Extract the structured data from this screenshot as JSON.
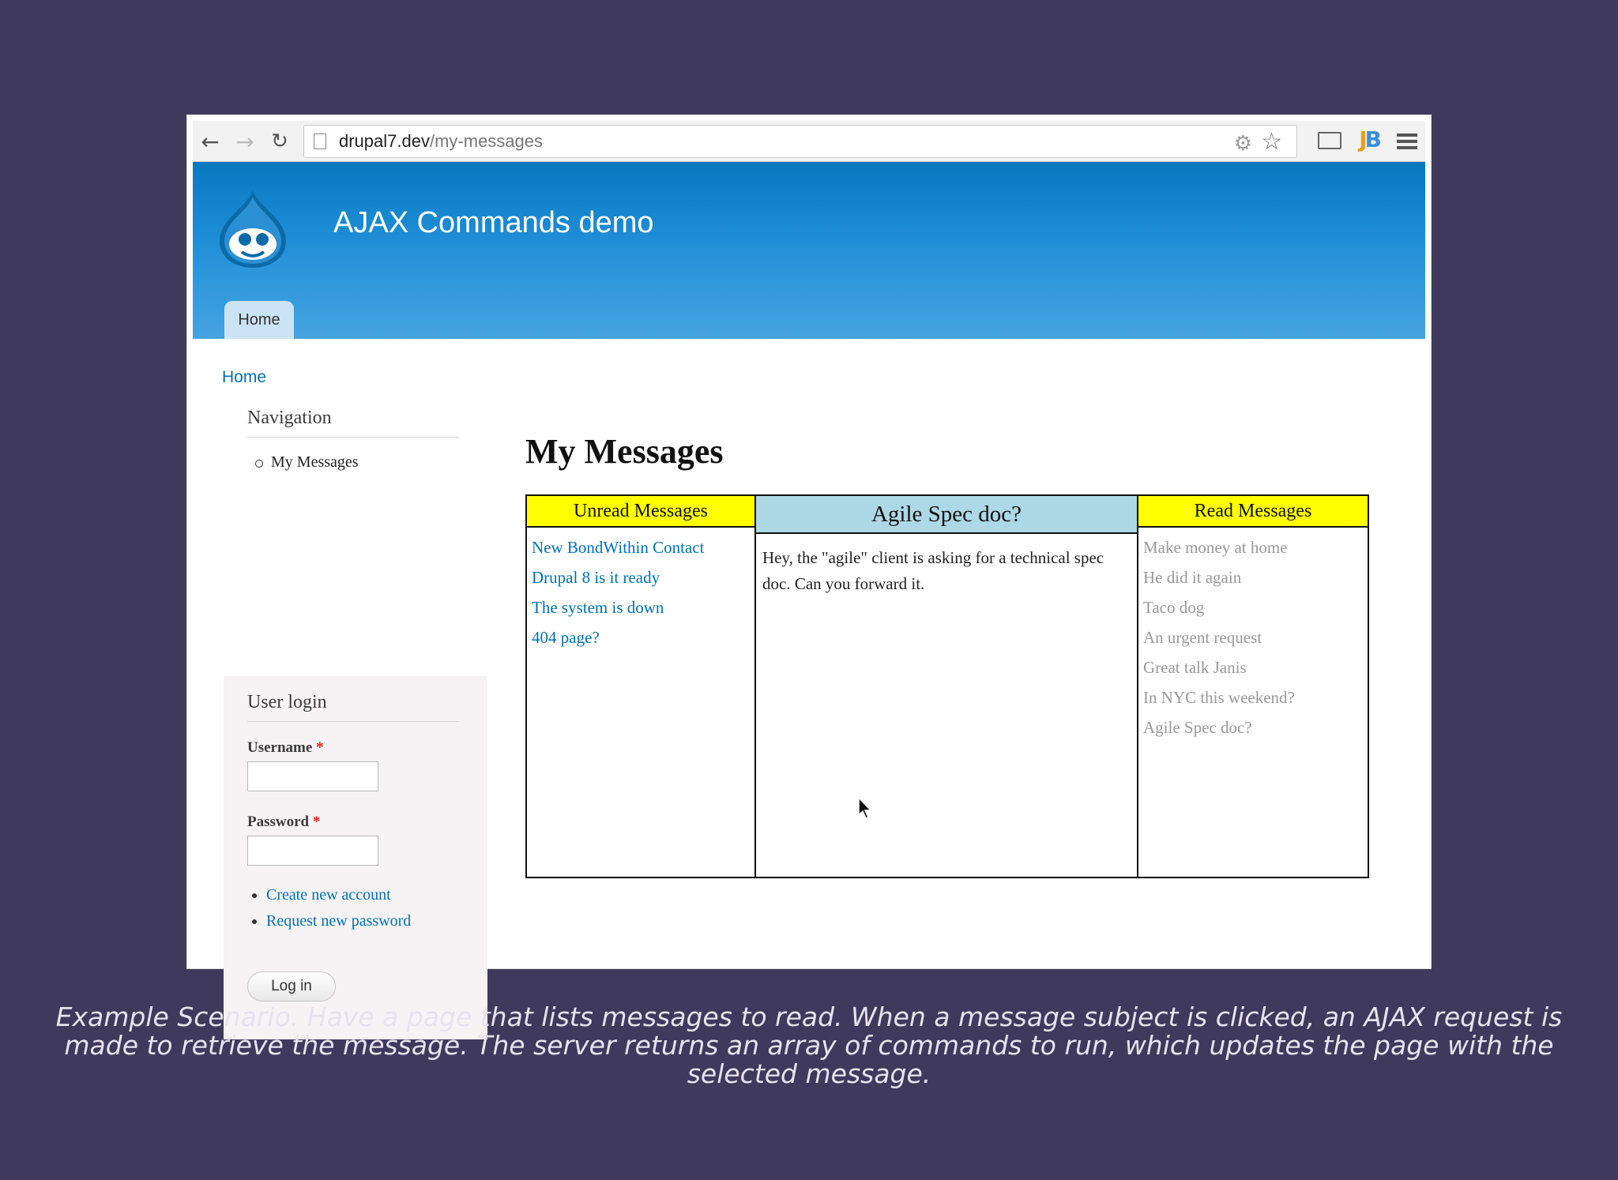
{
  "browser": {
    "url_host": "drupal7.dev",
    "url_path": "/my-messages"
  },
  "site": {
    "name": "AJAX Commands demo",
    "tabs": [
      {
        "label": "Home"
      }
    ],
    "breadcrumb": "Home"
  },
  "sidebar": {
    "navigation": {
      "title": "Navigation",
      "items": [
        "My Messages"
      ]
    },
    "login": {
      "title": "User login",
      "username_label": "Username",
      "password_label": "Password",
      "required_marker": "*",
      "links": [
        "Create new account",
        "Request new password"
      ],
      "submit_label": "Log in"
    }
  },
  "main": {
    "title": "My Messages",
    "unread": {
      "header": "Unread Messages",
      "items": [
        "New BondWithin Contact",
        "Drupal 8 is it ready",
        "The system is down",
        "404 page?"
      ]
    },
    "viewer": {
      "subject": "Agile Spec doc?",
      "body": "Hey, the \"agile\" client is asking for a technical spec doc. Can you forward it."
    },
    "read": {
      "header": "Read Messages",
      "items": [
        "Make money at home",
        "He did it again",
        "Taco dog",
        "An urgent request",
        "Great talk Janis",
        "In NYC this weekend?",
        "Agile Spec doc?"
      ]
    }
  },
  "caption": "Example Scenario. Have a page that lists messages to read. When a message subject is clicked, an AJAX request is made to retrieve the message. The server returns an array of commands to run, which updates the page with the selected message.",
  "colors": {
    "background": "#3f3a5c",
    "header_blue": "#0779bf",
    "link": "#0071b3",
    "column_header_yellow": "#ffff00",
    "viewer_header_blue": "#add8e6"
  }
}
